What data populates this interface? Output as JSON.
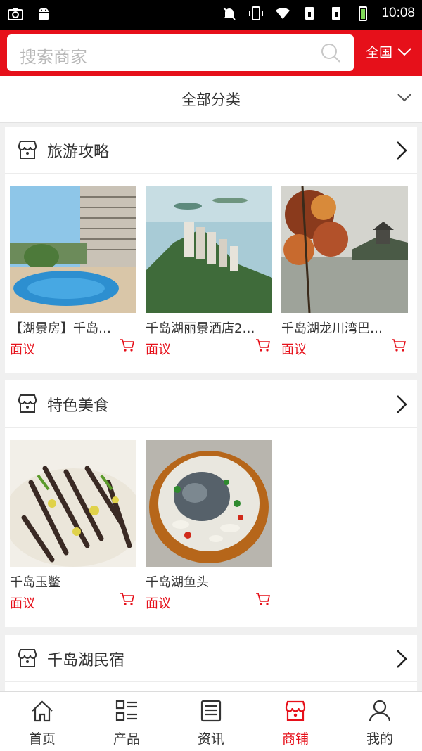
{
  "status_bar": {
    "time": "10:08"
  },
  "search": {
    "placeholder": "搜索商家",
    "region": "全国"
  },
  "category_bar": {
    "label": "全部分类"
  },
  "sections": [
    {
      "title": "旅游攻略",
      "items": [
        {
          "name": "【湖景房】千岛…",
          "price": "面议"
        },
        {
          "name": "千岛湖丽景酒店2…",
          "price": "面议"
        },
        {
          "name": "千岛湖龙川湾巴…",
          "price": "面议"
        }
      ]
    },
    {
      "title": "特色美食",
      "items": [
        {
          "name": "千岛玉鳖",
          "price": "面议"
        },
        {
          "name": "千岛湖鱼头",
          "price": "面议"
        }
      ]
    },
    {
      "title": "千岛湖民宿",
      "items": []
    }
  ],
  "nav": [
    {
      "label": "首页",
      "icon": "home-icon"
    },
    {
      "label": "产品",
      "icon": "list-icon"
    },
    {
      "label": "资讯",
      "icon": "news-icon"
    },
    {
      "label": "商铺",
      "icon": "shop-icon",
      "active": true
    },
    {
      "label": "我的",
      "icon": "user-icon"
    }
  ],
  "colors": {
    "accent": "#e6101a",
    "statusbar": "#000000",
    "background": "#f0f0f0"
  }
}
